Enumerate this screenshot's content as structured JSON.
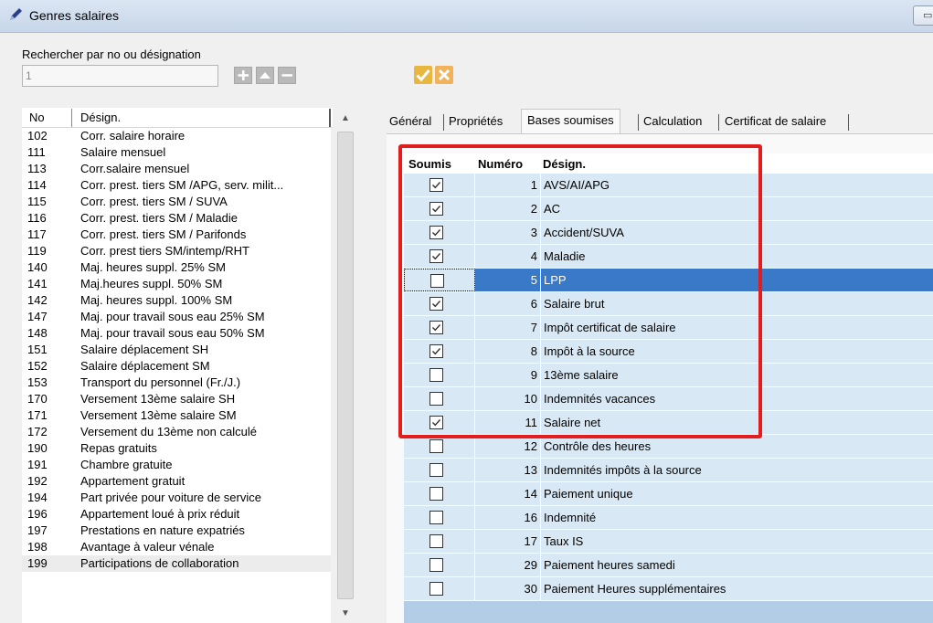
{
  "window": {
    "title": "Genres salaires",
    "winbtn": "▭"
  },
  "search": {
    "label": "Rechercher par no ou désignation",
    "value": "1"
  },
  "list": {
    "headers": {
      "no": "No",
      "desig": "Désign."
    },
    "rows": [
      {
        "no": "102",
        "desig": "Corr. salaire horaire"
      },
      {
        "no": "111",
        "desig": "Salaire mensuel"
      },
      {
        "no": "113",
        "desig": "Corr.salaire mensuel"
      },
      {
        "no": "114",
        "desig": "Corr. prest. tiers SM /APG, serv. milit..."
      },
      {
        "no": "115",
        "desig": "Corr. prest. tiers SM / SUVA"
      },
      {
        "no": "116",
        "desig": "Corr. prest. tiers SM / Maladie"
      },
      {
        "no": "117",
        "desig": "Corr. prest. tiers SM / Parifonds"
      },
      {
        "no": "119",
        "desig": "Corr. prest tiers SM/intemp/RHT"
      },
      {
        "no": "140",
        "desig": "Maj. heures suppl. 25% SM"
      },
      {
        "no": "141",
        "desig": "Maj.heures suppl. 50% SM"
      },
      {
        "no": "142",
        "desig": "Maj. heures suppl. 100% SM"
      },
      {
        "no": "147",
        "desig": "Maj. pour travail sous eau 25% SM"
      },
      {
        "no": "148",
        "desig": "Maj. pour travail sous eau 50% SM"
      },
      {
        "no": "151",
        "desig": "Salaire déplacement SH"
      },
      {
        "no": "152",
        "desig": "Salaire déplacement SM"
      },
      {
        "no": "153",
        "desig": "Transport du personnel (Fr./J.)"
      },
      {
        "no": "170",
        "desig": "Versement 13ème salaire SH"
      },
      {
        "no": "171",
        "desig": "Versement 13ème salaire SM"
      },
      {
        "no": "172",
        "desig": "Versement du 13ème non calculé"
      },
      {
        "no": "190",
        "desig": "Repas gratuits"
      },
      {
        "no": "191",
        "desig": "Chambre gratuite"
      },
      {
        "no": "192",
        "desig": "Appartement gratuit"
      },
      {
        "no": "194",
        "desig": "Part privée pour voiture de service"
      },
      {
        "no": "196",
        "desig": "Appartement loué à prix réduit"
      },
      {
        "no": "197",
        "desig": "Prestations en nature expatriés"
      },
      {
        "no": "198",
        "desig": "Avantage à valeur vénale"
      },
      {
        "no": "199",
        "desig": "Participations de collaboration"
      }
    ]
  },
  "tabs": [
    {
      "label": "Général"
    },
    {
      "label": "Propriétés"
    },
    {
      "label": "Bases soumises"
    },
    {
      "label": "Calculation"
    },
    {
      "label": "Certificat de salaire"
    }
  ],
  "grid": {
    "headers": {
      "soumis": "Soumis",
      "numero": "Numéro",
      "desig": "Désign."
    },
    "rows": [
      {
        "checked": true,
        "numero": "1",
        "desig": "AVS/AI/APG"
      },
      {
        "checked": true,
        "numero": "2",
        "desig": "AC"
      },
      {
        "checked": true,
        "numero": "3",
        "desig": "Accident/SUVA"
      },
      {
        "checked": true,
        "numero": "4",
        "desig": "Maladie"
      },
      {
        "checked": false,
        "numero": "5",
        "desig": "LPP",
        "selected": true
      },
      {
        "checked": true,
        "numero": "6",
        "desig": "Salaire brut"
      },
      {
        "checked": true,
        "numero": "7",
        "desig": "Impôt certificat de salaire"
      },
      {
        "checked": true,
        "numero": "8",
        "desig": "Impôt à la source"
      },
      {
        "checked": false,
        "numero": "9",
        "desig": "13ème salaire"
      },
      {
        "checked": false,
        "numero": "10",
        "desig": "Indemnités vacances"
      },
      {
        "checked": true,
        "numero": "11",
        "desig": "Salaire net"
      },
      {
        "checked": false,
        "numero": "12",
        "desig": "Contrôle des heures"
      },
      {
        "checked": false,
        "numero": "13",
        "desig": "Indemnités impôts à la source"
      },
      {
        "checked": false,
        "numero": "14",
        "desig": "Paiement unique"
      },
      {
        "checked": false,
        "numero": "16",
        "desig": "Indemnité"
      },
      {
        "checked": false,
        "numero": "17",
        "desig": "Taux IS"
      },
      {
        "checked": false,
        "numero": "29",
        "desig": "Paiement heures samedi"
      },
      {
        "checked": false,
        "numero": "30",
        "desig": "Paiement Heures supplémentaires"
      }
    ]
  },
  "colors": {
    "highlight": "#e11d1d",
    "selection": "#3a78c8",
    "gridRow": "#d8e8f5"
  },
  "icons": [
    "app-pen-icon",
    "add-icon",
    "arrow-up-icon",
    "remove-icon",
    "ok-check-icon",
    "cancel-x-icon",
    "checkbox-checked-icon"
  ]
}
